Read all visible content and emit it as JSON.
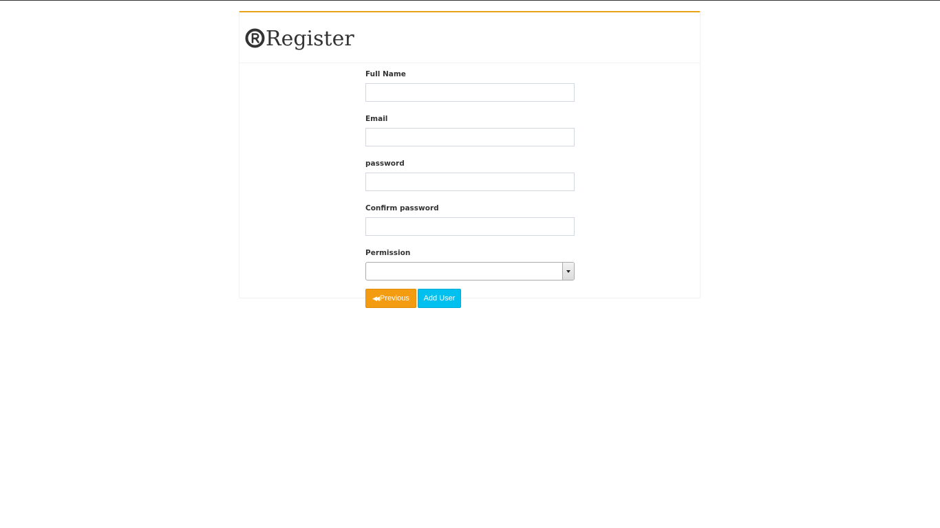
{
  "page": {
    "title": "Register",
    "accent_color": "#e8a317"
  },
  "form": {
    "full_name": {
      "label": "Full Name",
      "value": "",
      "placeholder": ""
    },
    "email": {
      "label": "Email",
      "value": "",
      "placeholder": ""
    },
    "password": {
      "label": "password",
      "value": "",
      "placeholder": ""
    },
    "confirm_password": {
      "label": "Confirm password",
      "value": "",
      "placeholder": ""
    },
    "permission": {
      "label": "Permission",
      "selected": ""
    }
  },
  "buttons": {
    "previous": {
      "label": "Previous",
      "icon": "fast-backward-icon",
      "color": "#f39c12"
    },
    "add_user": {
      "label": "Add User",
      "color": "#00c0ef"
    }
  },
  "icons": {
    "title_icon": "registered-icon"
  }
}
